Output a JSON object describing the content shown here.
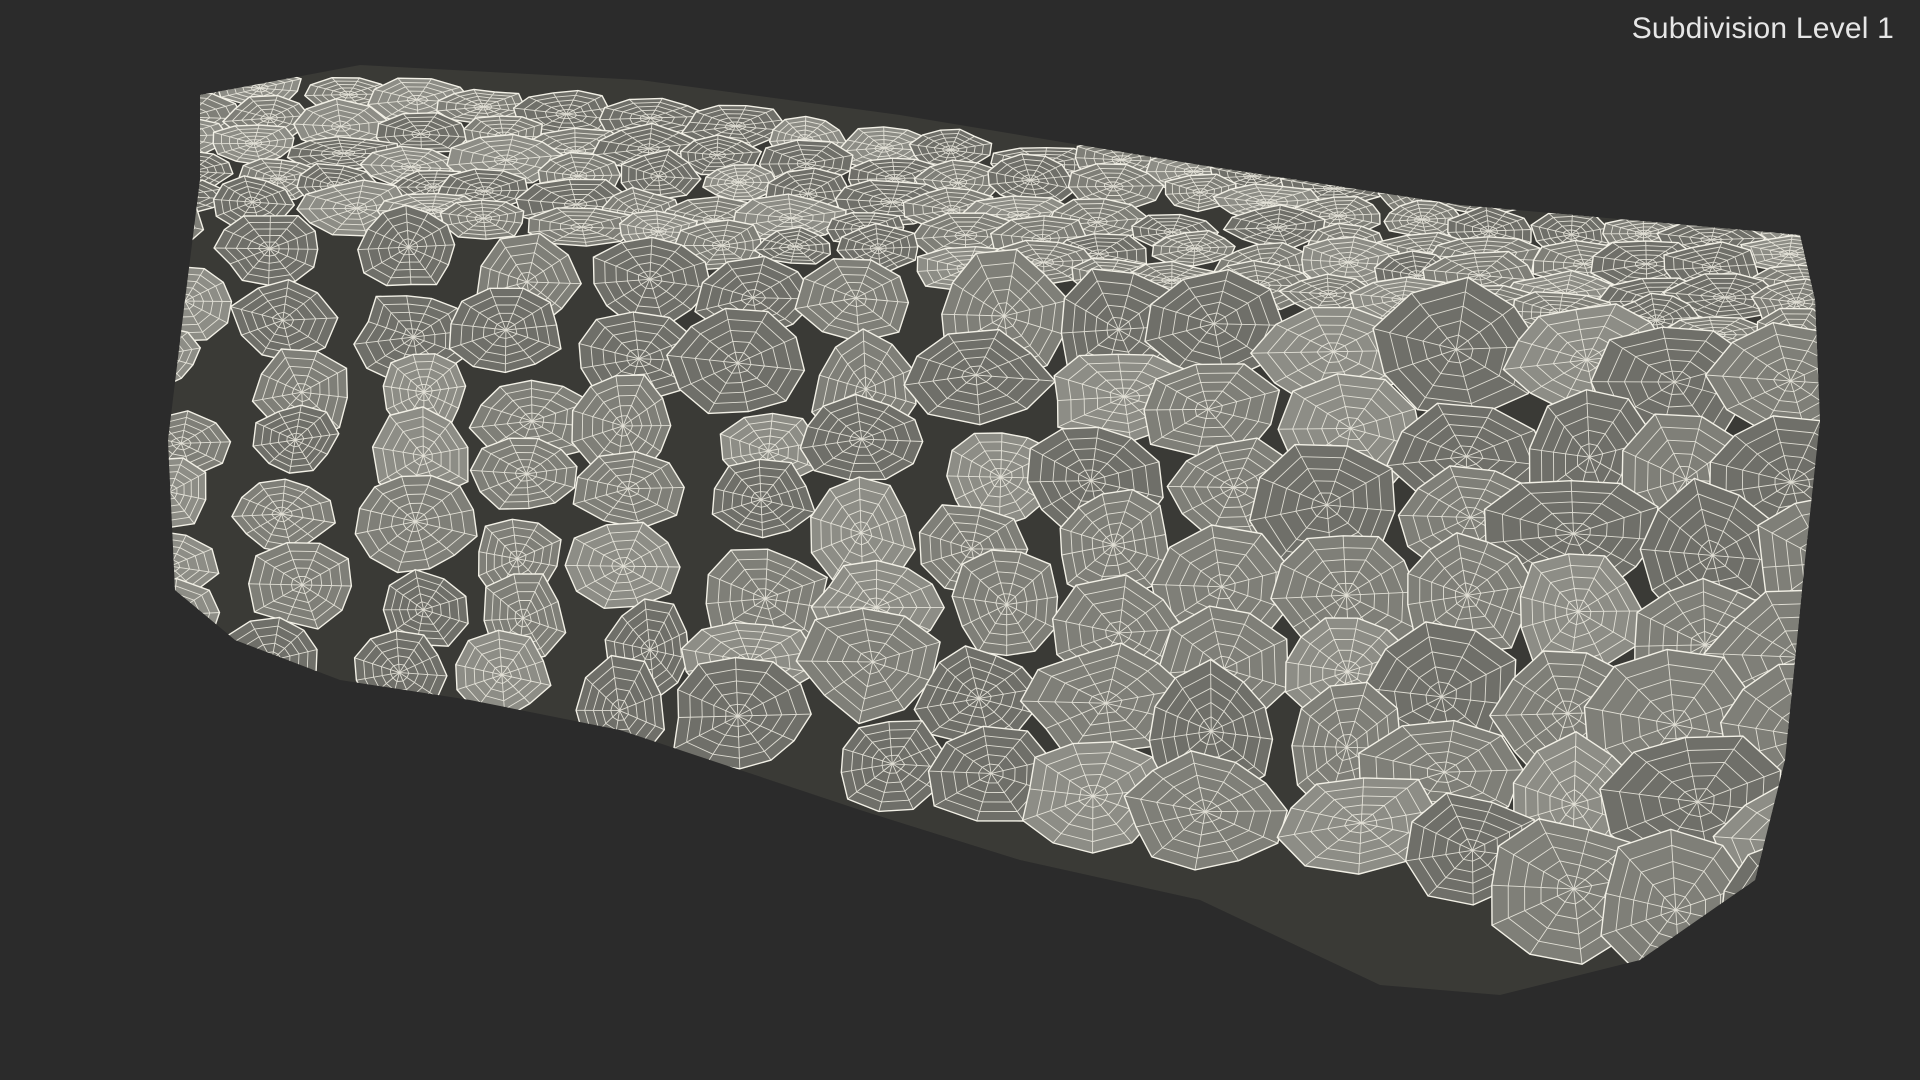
{
  "viewport": {
    "label": "Subdivision Level 1",
    "subject": "stone-wall-wireframe-model",
    "colors": {
      "background": "#2b2b2b",
      "stone_fill": "#7f7f78",
      "stone_fill_dark": "#6f6f69",
      "stone_fill_light": "#8d8d86",
      "wire": "#f2f0e6",
      "crevice": "#3a3a36"
    }
  }
}
